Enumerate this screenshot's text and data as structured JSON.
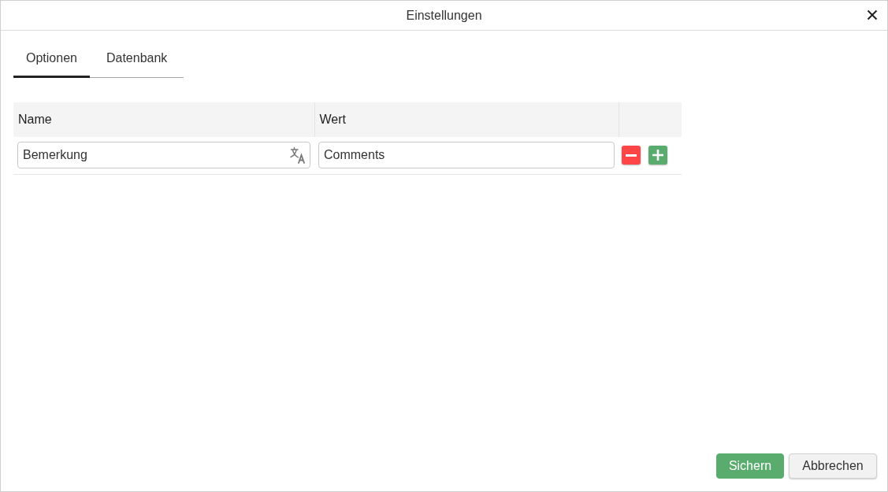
{
  "window": {
    "title": "Einstellungen"
  },
  "tabs": [
    {
      "label": "Optionen",
      "selected": true
    },
    {
      "label": "Datenbank",
      "selected": false
    }
  ],
  "table": {
    "columns": [
      "Name",
      "Wert"
    ],
    "rows": [
      {
        "name": "Bemerkung",
        "value": "Comments"
      }
    ]
  },
  "buttons": [
    {
      "label": "Sichern",
      "kind": "primary"
    },
    {
      "label": "Abbrechen",
      "kind": "secondary"
    }
  ]
}
